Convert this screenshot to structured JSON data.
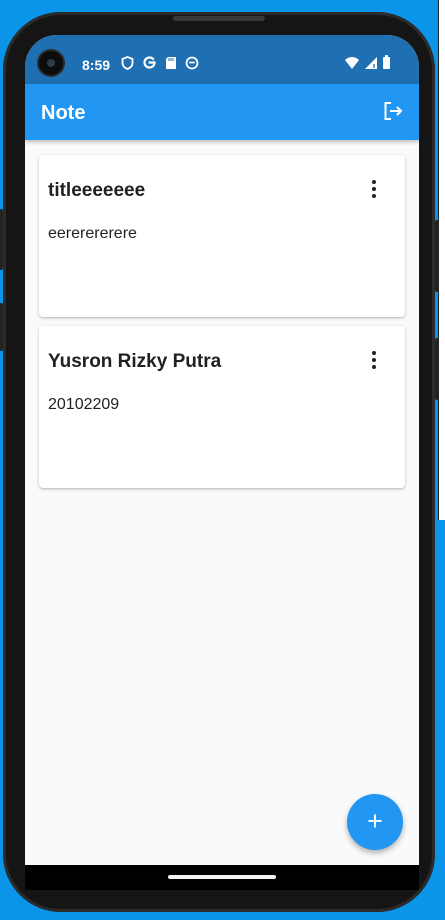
{
  "status_bar": {
    "time": "8:59",
    "left_icons": [
      "shield-icon",
      "google-icon",
      "sd-card-icon",
      "circle-app-icon"
    ],
    "right_icons": [
      "wifi-icon",
      "signal-icon",
      "battery-icon"
    ]
  },
  "app_bar": {
    "title": "Note",
    "action_icon": "logout-icon"
  },
  "notes": [
    {
      "title": "titleeeeeee",
      "body": "eererererere",
      "menu_icon": "more-vert-icon"
    },
    {
      "title": "Yusron Rizky Putra",
      "body": "20102209",
      "menu_icon": "more-vert-icon"
    }
  ],
  "fab": {
    "symbol": "+",
    "icon": "add-icon"
  },
  "colors": {
    "primary": "#2196f3",
    "status_bar": "#1f6fb3",
    "background": "#fafafa",
    "card": "#ffffff",
    "text": "#212121"
  }
}
